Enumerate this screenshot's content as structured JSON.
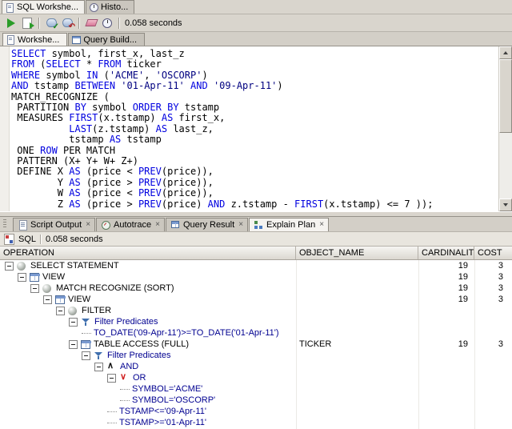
{
  "colors": {
    "keyword": "#0000e0",
    "string": "#000080",
    "predicate": "#000090",
    "run_green": "#2a9c28"
  },
  "window_tabs": [
    {
      "label": "SQL Workshe...",
      "icon": "worksheet-icon",
      "active": true
    },
    {
      "label": "Histo...",
      "icon": "history-icon",
      "active": false
    }
  ],
  "toolbar": {
    "icons": [
      "run",
      "run-script",
      "sep",
      "commit",
      "rollback",
      "sep",
      "clear",
      "history",
      "sep"
    ],
    "timing": "0.058 seconds"
  },
  "worksheet_tabs": [
    {
      "label": "Workshe...",
      "icon": "worksheet-icon",
      "active": true
    },
    {
      "label": "Query Build...",
      "icon": "query-builder-icon",
      "active": false
    }
  ],
  "editor": {
    "lines": [
      [
        [
          "k",
          "SELECT"
        ],
        [
          "p",
          " symbol, first_x, last_z"
        ]
      ],
      [
        [
          "k",
          "FROM"
        ],
        [
          "p",
          " ("
        ],
        [
          "k",
          "SELECT"
        ],
        [
          "p",
          " * "
        ],
        [
          "k",
          "FROM"
        ],
        [
          "p",
          " ticker"
        ]
      ],
      [
        [
          "k",
          "WHERE"
        ],
        [
          "p",
          " symbol "
        ],
        [
          "k",
          "IN"
        ],
        [
          "p",
          " ("
        ],
        [
          "s",
          "'ACME'"
        ],
        [
          "p",
          ", "
        ],
        [
          "s",
          "'OSCORP'"
        ],
        [
          "p",
          ")"
        ]
      ],
      [
        [
          "k",
          "AND"
        ],
        [
          "p",
          " tstamp "
        ],
        [
          "k",
          "BETWEEN"
        ],
        [
          "p",
          " "
        ],
        [
          "s",
          "'01-Apr-11'"
        ],
        [
          "p",
          " "
        ],
        [
          "k",
          "AND"
        ],
        [
          "p",
          " "
        ],
        [
          "s",
          "'09-Apr-11'"
        ],
        [
          "p",
          ")"
        ]
      ],
      [
        [
          "p",
          "MATCH_RECOGNIZE ("
        ]
      ],
      [
        [
          "p",
          " PARTITION "
        ],
        [
          "k",
          "BY"
        ],
        [
          "p",
          " symbol "
        ],
        [
          "k",
          "ORDER"
        ],
        [
          "p",
          " "
        ],
        [
          "k",
          "BY"
        ],
        [
          "p",
          " tstamp"
        ]
      ],
      [
        [
          "p",
          " MEASURES "
        ],
        [
          "k",
          "FIRST"
        ],
        [
          "p",
          "(x.tstamp) "
        ],
        [
          "k",
          "AS"
        ],
        [
          "p",
          " first_x,"
        ]
      ],
      [
        [
          "p",
          "          "
        ],
        [
          "k",
          "LAST"
        ],
        [
          "p",
          "(z.tstamp) "
        ],
        [
          "k",
          "AS"
        ],
        [
          "p",
          " last_z,"
        ]
      ],
      [
        [
          "p",
          "          tstamp "
        ],
        [
          "k",
          "AS"
        ],
        [
          "p",
          " tstamp"
        ]
      ],
      [
        [
          "p",
          " ONE "
        ],
        [
          "k",
          "ROW"
        ],
        [
          "p",
          " PER MATCH"
        ]
      ],
      [
        [
          "p",
          " PATTERN (X+ Y+ W+ Z+)"
        ]
      ],
      [
        [
          "p",
          " DEFINE X "
        ],
        [
          "k",
          "AS"
        ],
        [
          "p",
          " (price < "
        ],
        [
          "k",
          "PREV"
        ],
        [
          "p",
          "(price)),"
        ]
      ],
      [
        [
          "p",
          "        Y "
        ],
        [
          "k",
          "AS"
        ],
        [
          "p",
          " (price > "
        ],
        [
          "k",
          "PREV"
        ],
        [
          "p",
          "(price)),"
        ]
      ],
      [
        [
          "p",
          "        W "
        ],
        [
          "k",
          "AS"
        ],
        [
          "p",
          " (price < "
        ],
        [
          "k",
          "PREV"
        ],
        [
          "p",
          "(price)),"
        ]
      ],
      [
        [
          "p",
          "        Z "
        ],
        [
          "k",
          "AS"
        ],
        [
          "p",
          " (price > "
        ],
        [
          "k",
          "PREV"
        ],
        [
          "p",
          "(price) "
        ],
        [
          "k",
          "AND"
        ],
        [
          "p",
          " z.tstamp - "
        ],
        [
          "k",
          "FIRST"
        ],
        [
          "p",
          "(x.tstamp) <= 7 ));"
        ]
      ]
    ]
  },
  "bottom_tabs": [
    {
      "label": "Script Output",
      "icon": "script-output-icon",
      "active": false
    },
    {
      "label": "Autotrace",
      "icon": "autotrace-icon",
      "active": false
    },
    {
      "label": "Query Result",
      "icon": "query-result-icon",
      "active": false
    },
    {
      "label": "Explain Plan",
      "icon": "explain-plan-icon",
      "active": true
    }
  ],
  "explain_bar": {
    "label": "SQL",
    "timing": "0.058 seconds"
  },
  "plan": {
    "columns": [
      "OPERATION",
      "OBJECT_NAME",
      "CARDINALITY",
      "COST"
    ],
    "rows": [
      {
        "indent": 0,
        "box": true,
        "icon": "operation",
        "label": "SELECT STATEMENT",
        "object": "",
        "card": "19",
        "cost": "3",
        "link": false
      },
      {
        "indent": 1,
        "box": true,
        "icon": "table",
        "label": "VIEW",
        "object": "",
        "card": "19",
        "cost": "3",
        "link": false
      },
      {
        "indent": 2,
        "box": true,
        "icon": "operation",
        "label": "MATCH RECOGNIZE (SORT)",
        "object": "",
        "card": "19",
        "cost": "3",
        "link": false
      },
      {
        "indent": 3,
        "box": true,
        "icon": "table",
        "label": "VIEW",
        "object": "",
        "card": "19",
        "cost": "3",
        "link": false
      },
      {
        "indent": 4,
        "box": true,
        "icon": "operation",
        "label": "FILTER",
        "object": "",
        "card": "",
        "cost": "",
        "link": false
      },
      {
        "indent": 5,
        "box": true,
        "icon": "filter",
        "label": "Filter Predicates",
        "object": "",
        "card": "",
        "cost": "",
        "link": true
      },
      {
        "indent": 6,
        "box": false,
        "icon": null,
        "label": "TO_DATE('09-Apr-11')>=TO_DATE('01-Apr-11')",
        "object": "",
        "card": "",
        "cost": "",
        "link": true
      },
      {
        "indent": 5,
        "box": true,
        "icon": "table",
        "label": "TABLE ACCESS (FULL)",
        "object": "TICKER",
        "card": "19",
        "cost": "3",
        "link": false
      },
      {
        "indent": 6,
        "box": true,
        "icon": "filter",
        "label": "Filter Predicates",
        "object": "",
        "card": "",
        "cost": "",
        "link": true
      },
      {
        "indent": 7,
        "box": true,
        "icon": "and",
        "label": "AND",
        "object": "",
        "card": "",
        "cost": "",
        "link": true
      },
      {
        "indent": 8,
        "box": true,
        "icon": "or",
        "label": "OR",
        "object": "",
        "card": "",
        "cost": "",
        "link": true
      },
      {
        "indent": 9,
        "box": false,
        "icon": null,
        "label": "SYMBOL='ACME'",
        "object": "",
        "card": "",
        "cost": "",
        "link": true
      },
      {
        "indent": 9,
        "box": false,
        "icon": null,
        "label": "SYMBOL='OSCORP'",
        "object": "",
        "card": "",
        "cost": "",
        "link": true
      },
      {
        "indent": 8,
        "box": false,
        "icon": null,
        "label": "TSTAMP<='09-Apr-11'",
        "object": "",
        "card": "",
        "cost": "",
        "link": true
      },
      {
        "indent": 8,
        "box": false,
        "icon": null,
        "label": "TSTAMP>='01-Apr-11'",
        "object": "",
        "card": "",
        "cost": "",
        "link": true
      }
    ]
  }
}
